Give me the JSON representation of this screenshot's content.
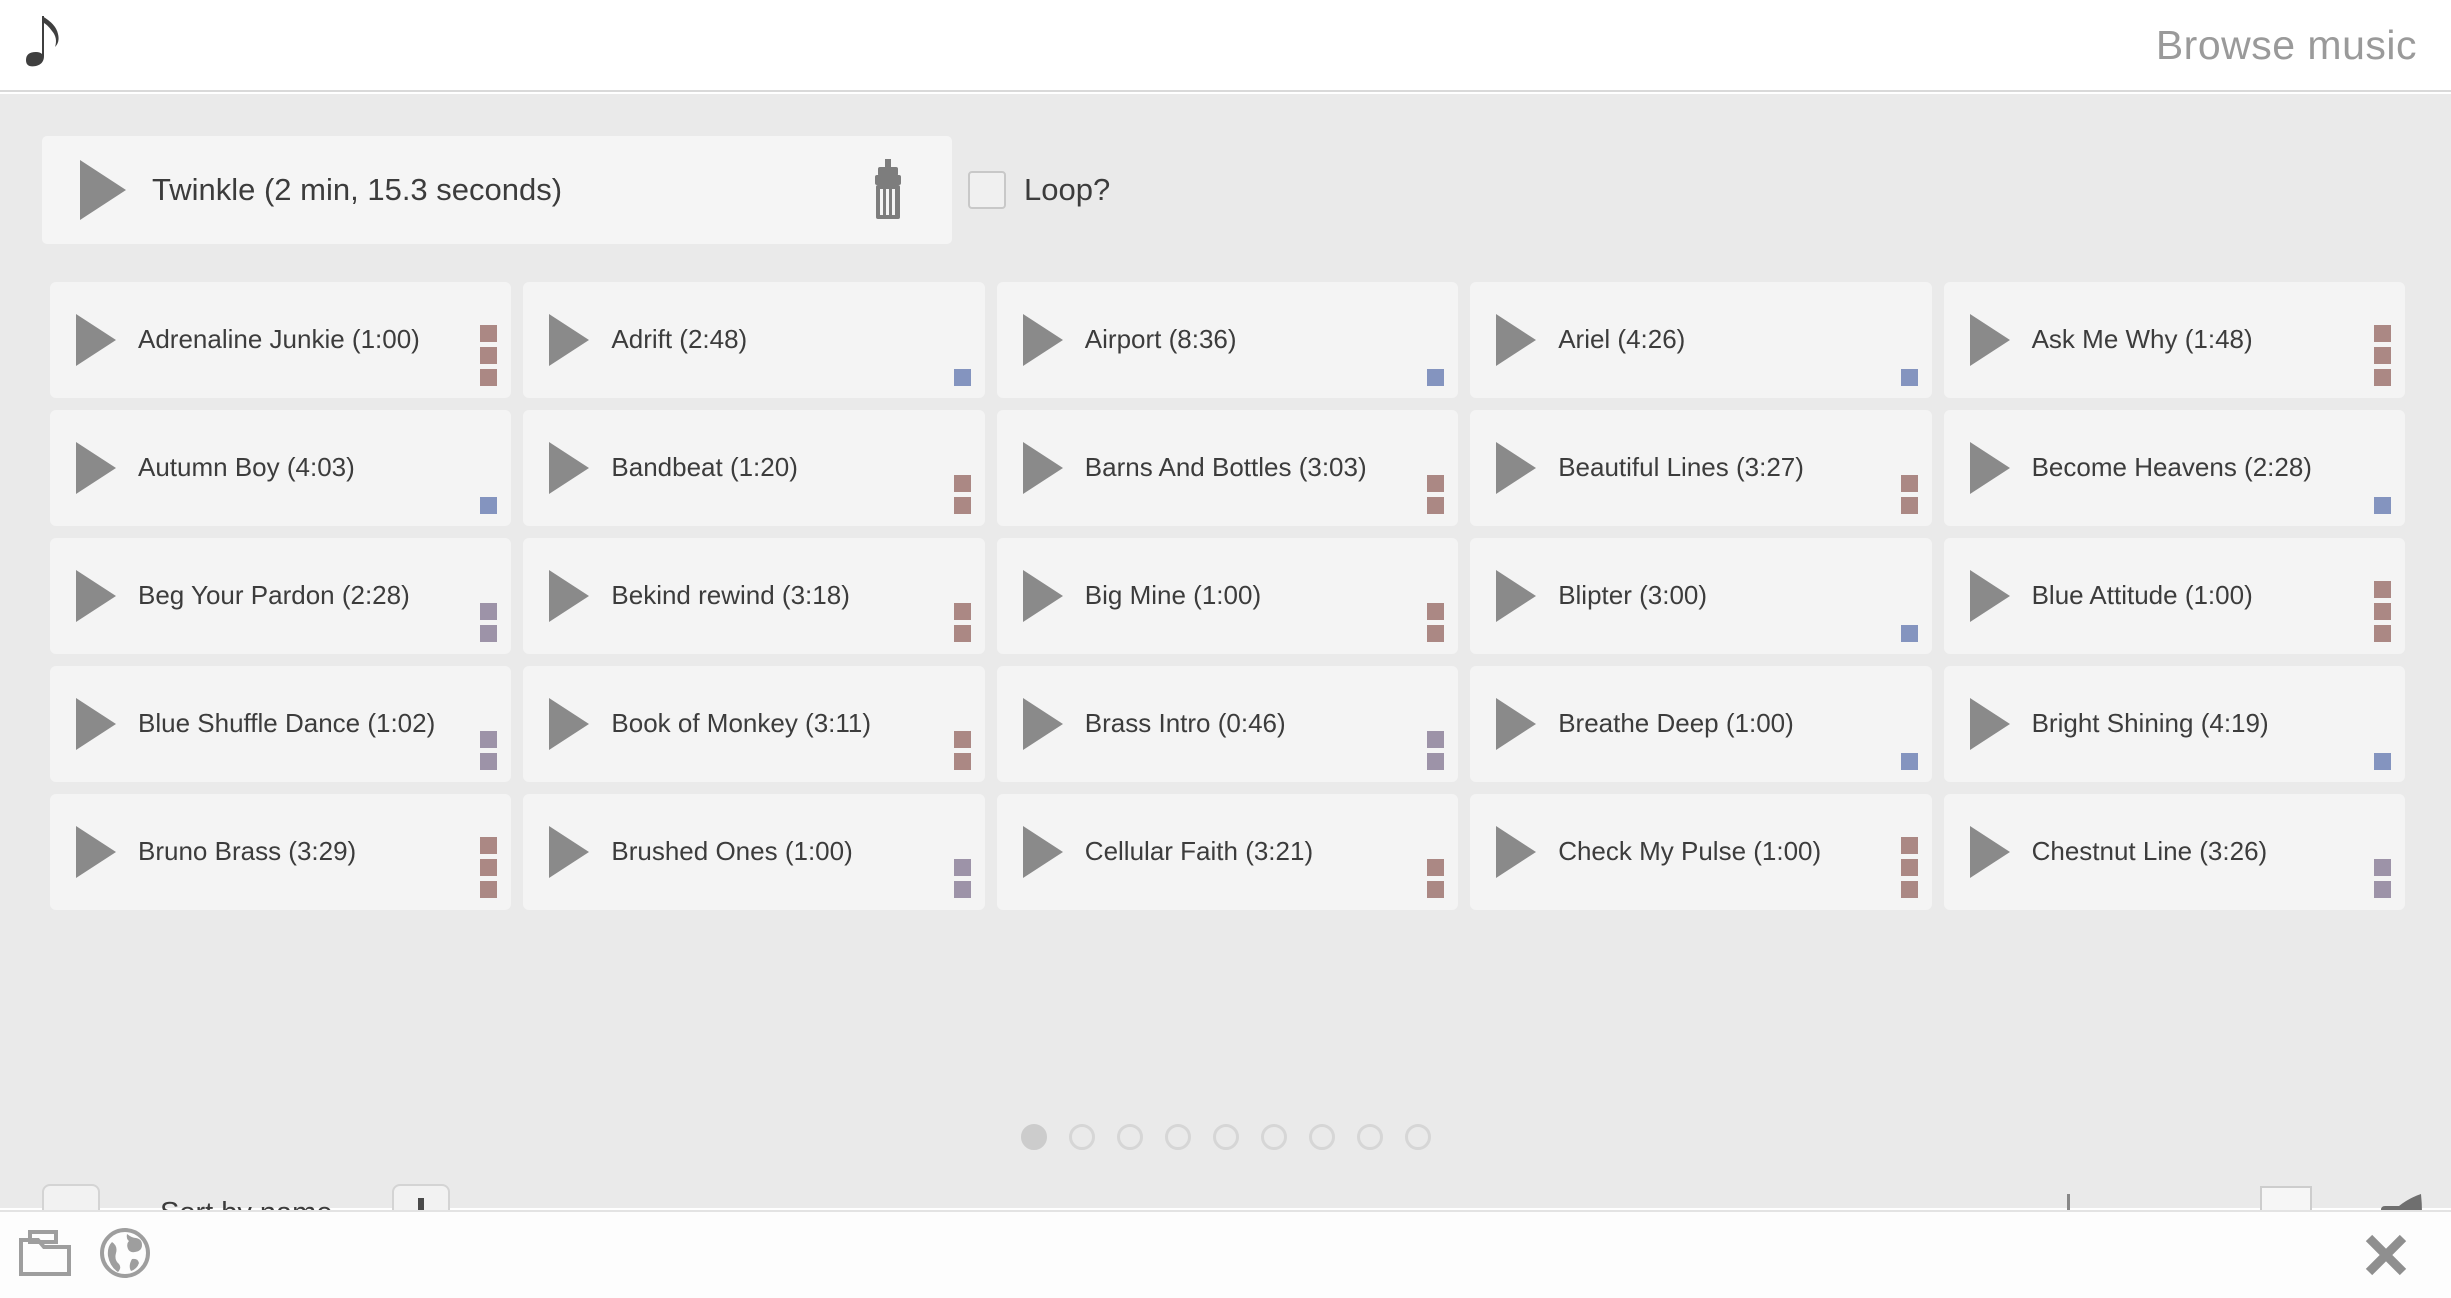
{
  "header": {
    "logo_icon": "music-note-icon",
    "title": "Browse music"
  },
  "now_playing": {
    "play_icon": "play-icon",
    "track_label": "Twinkle (2 min, 15.3 seconds)",
    "delete_icon": "trash-icon",
    "loop_label": "Loop?",
    "loop_checked": false
  },
  "colors": {
    "panel_bg": "#eaeaea",
    "card_bg": "#f4f4f4",
    "level_rose": "#ab8884",
    "level_purple": "#9d93a8",
    "level_blue": "#8494bf",
    "text": "#3c3c3c",
    "title_gray": "#9a9a9a"
  },
  "tracks": [
    {
      "title": "Adrenaline Junkie (1:00)",
      "level": 3,
      "color": "#ab8884"
    },
    {
      "title": "Adrift (2:48)",
      "level": 1,
      "color": "#8494bf"
    },
    {
      "title": "Airport (8:36)",
      "level": 1,
      "color": "#8494bf"
    },
    {
      "title": "Ariel (4:26)",
      "level": 1,
      "color": "#8494bf"
    },
    {
      "title": "Ask Me Why (1:48)",
      "level": 3,
      "color": "#ab8884"
    },
    {
      "title": "Autumn Boy (4:03)",
      "level": 1,
      "color": "#8494bf"
    },
    {
      "title": "Bandbeat (1:20)",
      "level": 2,
      "color": "#ab8884"
    },
    {
      "title": "Barns And Bottles (3:03)",
      "level": 2,
      "color": "#ab8884"
    },
    {
      "title": "Beautiful Lines (3:27)",
      "level": 2,
      "color": "#ab8884"
    },
    {
      "title": "Become Heavens (2:28)",
      "level": 1,
      "color": "#8494bf"
    },
    {
      "title": "Beg Your Pardon (2:28)",
      "level": 2,
      "color": "#9d93a8"
    },
    {
      "title": "Bekind rewind (3:18)",
      "level": 2,
      "color": "#ab8884"
    },
    {
      "title": "Big Mine (1:00)",
      "level": 2,
      "color": "#ab8884"
    },
    {
      "title": "Blipter (3:00)",
      "level": 1,
      "color": "#8494bf"
    },
    {
      "title": "Blue Attitude (1:00)",
      "level": 3,
      "color": "#ab8884"
    },
    {
      "title": "Blue Shuffle Dance (1:02)",
      "level": 2,
      "color": "#9d93a8"
    },
    {
      "title": "Book of Monkey (3:11)",
      "level": 2,
      "color": "#ab8884"
    },
    {
      "title": "Brass Intro (0:46)",
      "level": 2,
      "color": "#9d93a8"
    },
    {
      "title": "Breathe Deep (1:00)",
      "level": 1,
      "color": "#8494bf"
    },
    {
      "title": "Bright Shining (4:19)",
      "level": 1,
      "color": "#8494bf"
    },
    {
      "title": "Bruno Brass (3:29)",
      "level": 3,
      "color": "#ab8884"
    },
    {
      "title": "Brushed Ones (1:00)",
      "level": 2,
      "color": "#9d93a8"
    },
    {
      "title": "Cellular Faith (3:21)",
      "level": 2,
      "color": "#ab8884"
    },
    {
      "title": "Check My Pulse (1:00)",
      "level": 3,
      "color": "#ab8884"
    },
    {
      "title": "Chestnut Line (3:26)",
      "level": 2,
      "color": "#9d93a8"
    }
  ],
  "pagination": {
    "total_pages": 9,
    "current_page": 1
  },
  "controls": {
    "decrease_label": "–",
    "sort_label": "Sort by name",
    "increase_label": "+"
  },
  "volume": {
    "value_percent": 78,
    "speaker_icon": "speaker-icon"
  },
  "bottom_bar": {
    "folder_icon": "folder-icon",
    "globe_icon": "globe-icon",
    "close_icon": "close-icon"
  }
}
